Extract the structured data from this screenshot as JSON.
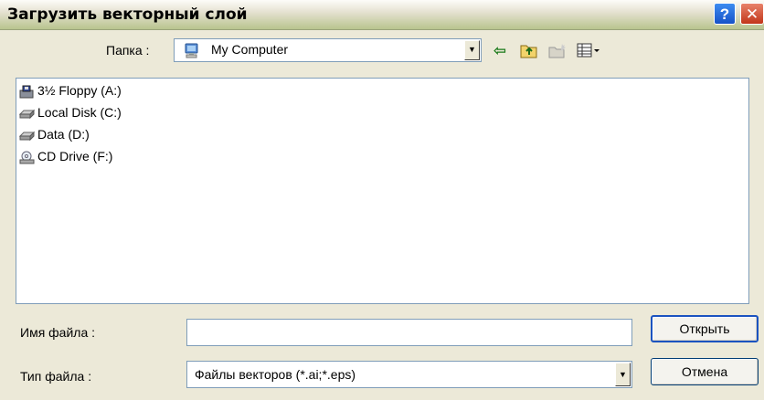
{
  "window": {
    "title": "Загрузить векторный слой",
    "help_icon": "?",
    "close_icon": "✕"
  },
  "lookin": {
    "label": "Папка :",
    "value": "My Computer"
  },
  "toolbar": {
    "back_icon": "⇦",
    "up_icon": "up-folder-icon",
    "newfolder_icon": "new-folder-icon",
    "views_icon": "views-menu-icon"
  },
  "files": [
    {
      "label": "3½ Floppy (A:)",
      "icon": "floppy-drive-icon"
    },
    {
      "label": "Local Disk (C:)",
      "icon": "hard-disk-icon"
    },
    {
      "label": "Data (D:)",
      "icon": "hard-disk-icon"
    },
    {
      "label": "CD Drive (F:)",
      "icon": "cd-drive-icon"
    }
  ],
  "filename": {
    "label": "Имя файла :",
    "value": ""
  },
  "filetype": {
    "label": "Тип файла :",
    "value": "Файлы векторов (*.ai;*.eps)"
  },
  "buttons": {
    "open": "Открыть",
    "cancel": "Отмена"
  }
}
